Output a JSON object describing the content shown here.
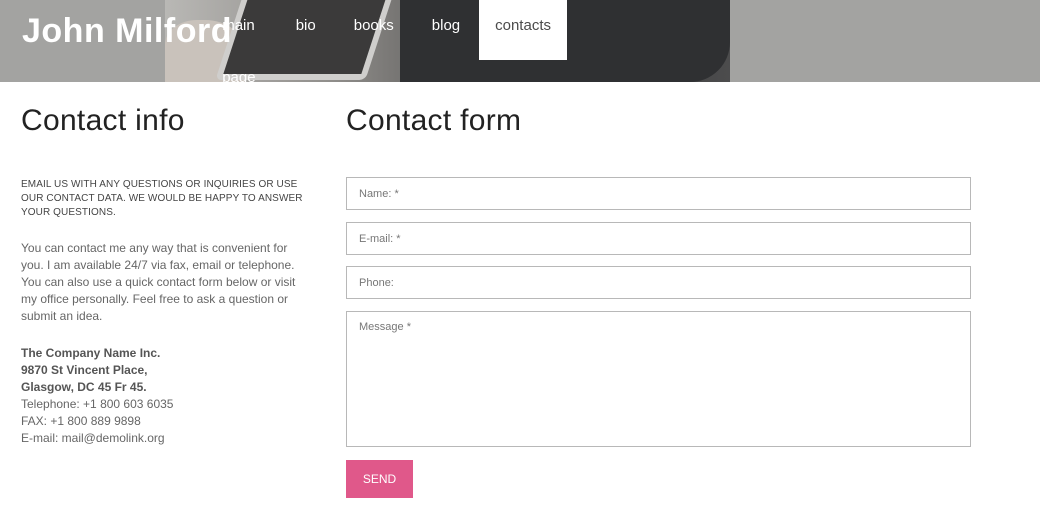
{
  "header": {
    "logo": "John Milford",
    "nav": [
      {
        "label": "main page"
      },
      {
        "label": "bio"
      },
      {
        "label": "books"
      },
      {
        "label": "blog"
      },
      {
        "label": "contacts",
        "active": true
      }
    ]
  },
  "contact_info": {
    "title": "Contact info",
    "intro_caps": "EMAIL US WITH ANY QUESTIONS OR INQUIRIES OR USE OUR CONTACT DATA. WE WOULD BE HAPPY TO ANSWER YOUR QUESTIONS.",
    "intro_body": "You can contact me any way that is convenient for you. I am available 24/7 via fax, email or telephone. You can also use a quick contact form below or visit my office personally. Feel free to ask a question or submit an idea.",
    "company": "The Company Name Inc.",
    "street": "9870 St Vincent Place,",
    "city": "Glasgow, DC 45 Fr 45.",
    "telephone": "Telephone: +1 800 603 6035",
    "fax": "FAX: +1 800 889 9898",
    "email": "E-mail: mail@demolink.org"
  },
  "contact_form": {
    "title": "Contact form",
    "name_placeholder": "Name: *",
    "email_placeholder": "E-mail: *",
    "phone_placeholder": "Phone:",
    "message_placeholder": "Message *",
    "send_label": "SEND"
  },
  "colors": {
    "header_bg": "#a3a3a1",
    "accent": "#e0588a"
  }
}
